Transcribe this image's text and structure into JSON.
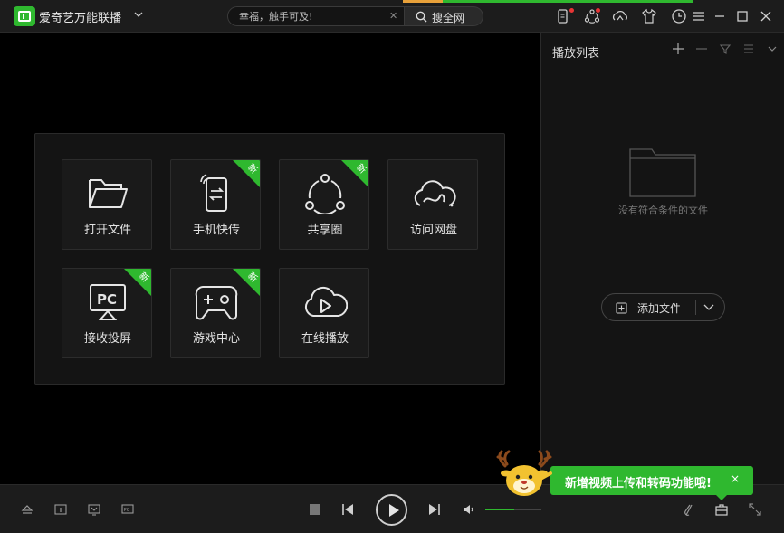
{
  "titlebar": {
    "app_title": "爱奇艺万能联播",
    "search_placeholder": "幸福，触手可及!",
    "search_button": "搜全网",
    "icons": [
      "phone-notify-icon",
      "share-circle-icon",
      "cloud-icon",
      "skin-shirt-icon",
      "history-clock-icon"
    ],
    "window_controls": [
      "menu-icon",
      "minimize-icon",
      "maximize-icon",
      "close-icon"
    ]
  },
  "launcher": {
    "tiles": [
      {
        "label": "打开文件",
        "icon": "folder-open-icon",
        "new": false
      },
      {
        "label": "手机快传",
        "icon": "phone-transfer-icon",
        "new": true
      },
      {
        "label": "共享圈",
        "icon": "share-circle-icon",
        "new": true
      },
      {
        "label": "访问网盘",
        "icon": "cloud-drive-icon",
        "new": false
      },
      {
        "label": "接收投屏",
        "icon": "pc-cast-icon",
        "new": true
      },
      {
        "label": "游戏中心",
        "icon": "gamepad-icon",
        "new": true
      },
      {
        "label": "在线播放",
        "icon": "cloud-play-icon",
        "new": false
      }
    ],
    "new_badge": "新"
  },
  "playlist": {
    "title": "播放列表",
    "empty_text": "没有符合条件的文件",
    "add_file_label": "添加文件"
  },
  "toast": {
    "text": "新增视频上传和转码功能哦!",
    "close": "×"
  },
  "player": {
    "volume": 0.52
  },
  "colors": {
    "accent": "#2fb82f",
    "background": "#000000",
    "panel": "#141414"
  }
}
